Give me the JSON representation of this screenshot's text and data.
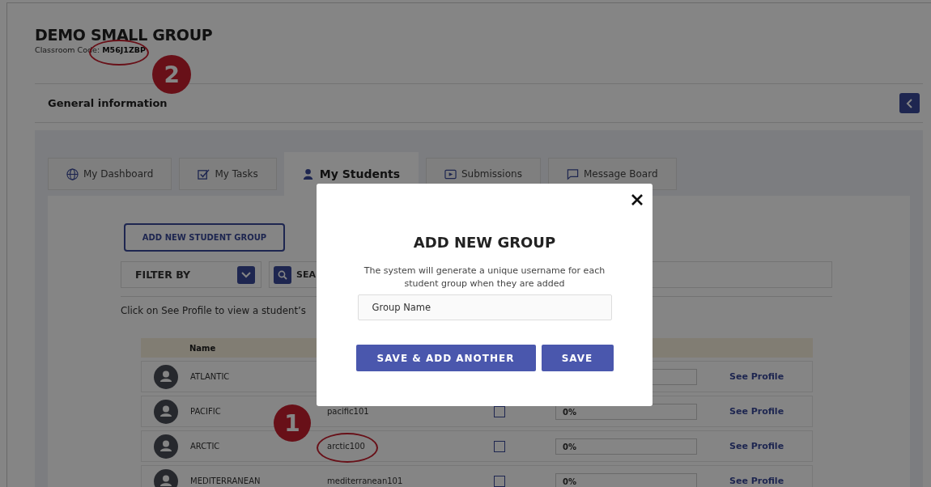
{
  "header": {
    "title": "DEMO SMALL GROUP",
    "code_label": "Classroom Code:",
    "code": "M56J1ZBP",
    "code_circled": true,
    "code_marker": "2"
  },
  "section": {
    "title": "General information"
  },
  "tabs": [
    {
      "label": "My Dashboard",
      "selected": false
    },
    {
      "label": "My Tasks",
      "selected": false
    },
    {
      "label": "My Students",
      "selected": true
    },
    {
      "label": "Submissions",
      "selected": false
    },
    {
      "label": "Message Board",
      "selected": false
    }
  ],
  "add_group_button": "ADD NEW STUDENT GROUP",
  "filter": {
    "label": "FILTER BY"
  },
  "search": {
    "label": "SEA"
  },
  "hint": "Click on See Profile to view a student’s",
  "table": {
    "columns": [
      "Name"
    ],
    "rows": [
      {
        "name": "ATLANTIC",
        "link": "See Profile"
      },
      {
        "name": "PACIFIC",
        "username": "pacific101",
        "percent": "0%",
        "link": "See Profile",
        "checked": false
      },
      {
        "name": "ARCTIC",
        "username": "arctic100",
        "percent": "0%",
        "link": "See Profile",
        "checked": false,
        "circled": true,
        "marker": "1"
      },
      {
        "name": "MEDITERRANEAN",
        "username": "mediterranean101",
        "percent": "0%",
        "link": "See Profile",
        "checked": false
      }
    ]
  },
  "modal": {
    "title": "ADD NEW GROUP",
    "text": "The system will generate a unique username for each student group when they are added",
    "field": {
      "placeholder": "Group Name"
    },
    "buttons": [
      "SAVE & ADD ANOTHER",
      "SAVE"
    ]
  }
}
